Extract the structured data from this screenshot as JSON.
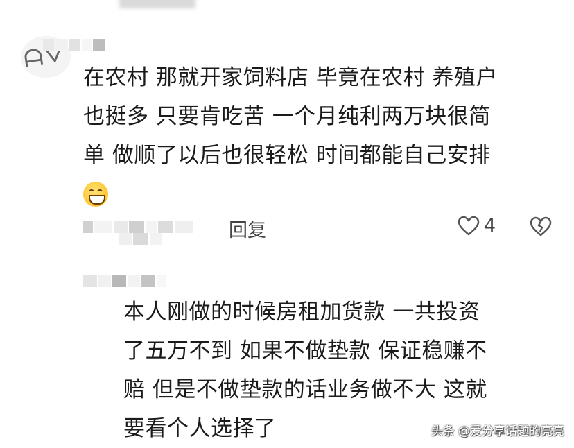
{
  "comment1": {
    "text_lines": [
      "在农村 那就开家饲料店 毕竟在农村 养殖户",
      "也挺多 只要肯吃苦 一个月纯利两万块很简",
      "单 做顺了以后也很轻松 时间都能自己安排"
    ],
    "emoji": "grinning-face-emoji",
    "reply_label": "回复",
    "like_count": "4"
  },
  "comment2": {
    "text_lines": [
      "本人刚做的时候房租加货款 一共投资",
      "了五万不到  如果不做垫款 保证稳赚不",
      "赔 但是不做垫款的话业务做不大 这就",
      "要看个人选择了"
    ]
  },
  "watermark": "头条 @爱分享话题的亮亮",
  "colors": {
    "text": "#1b1b1b",
    "meta": "#555555",
    "icon": "#555555",
    "mosaic_light": "#e6e6e6",
    "mosaic_dark": "#b5b5b5"
  }
}
